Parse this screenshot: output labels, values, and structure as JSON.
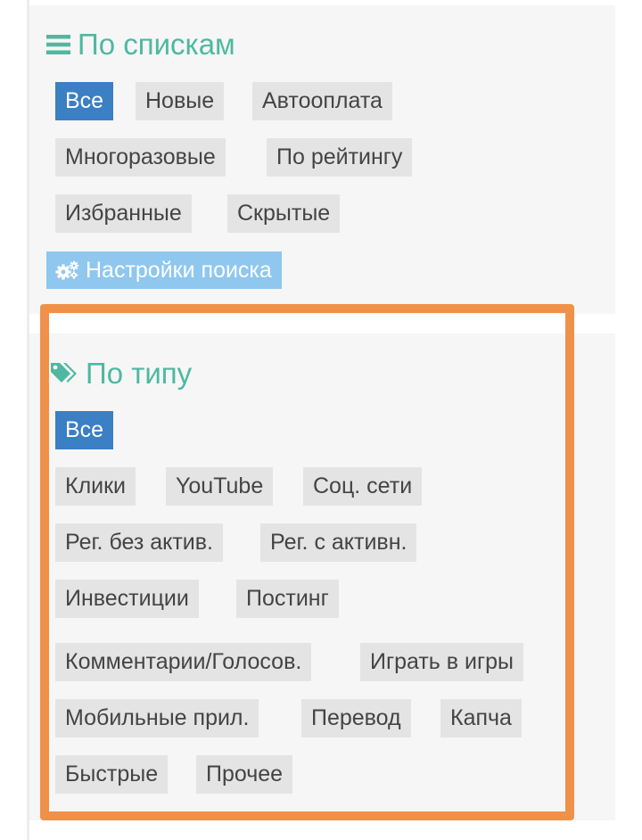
{
  "lists_section": {
    "title": "По спискам",
    "icon": "list-icon",
    "tags": [
      {
        "label": "Все",
        "active": true
      },
      {
        "label": "Новые",
        "active": false
      },
      {
        "label": "Автооплата",
        "active": false
      },
      {
        "label": "Многоразовые",
        "active": false
      },
      {
        "label": "По рейтингу",
        "active": false
      },
      {
        "label": "Избранные",
        "active": false
      },
      {
        "label": "Скрытые",
        "active": false
      }
    ],
    "settings_button": {
      "label": "Настройки поиска",
      "icon": "gears-icon"
    }
  },
  "types_section": {
    "title": "По типу",
    "icon": "tags-icon",
    "tags": [
      {
        "label": "Все",
        "active": true
      },
      {
        "label": "Клики",
        "active": false
      },
      {
        "label": "YouTube",
        "active": false
      },
      {
        "label": "Соц. сети",
        "active": false
      },
      {
        "label": "Рег. без актив.",
        "active": false
      },
      {
        "label": "Рег. с активн.",
        "active": false
      },
      {
        "label": "Инвестиции",
        "active": false
      },
      {
        "label": "Постинг",
        "active": false
      },
      {
        "label": "Комментарии/Голосов.",
        "active": false
      },
      {
        "label": "Играть в игры",
        "active": false
      },
      {
        "label": "Мобильные прил.",
        "active": false
      },
      {
        "label": "Перевод",
        "active": false
      },
      {
        "label": "Капча",
        "active": false
      },
      {
        "label": "Быстрые",
        "active": false
      },
      {
        "label": "Прочее",
        "active": false
      }
    ]
  },
  "colors": {
    "heading": "#4fb8a0",
    "active_tag": "#3b7fc4",
    "tag_bg": "#e4e4e4",
    "settings_button": "#8fc7ef",
    "highlight_border": "#f0914a"
  }
}
